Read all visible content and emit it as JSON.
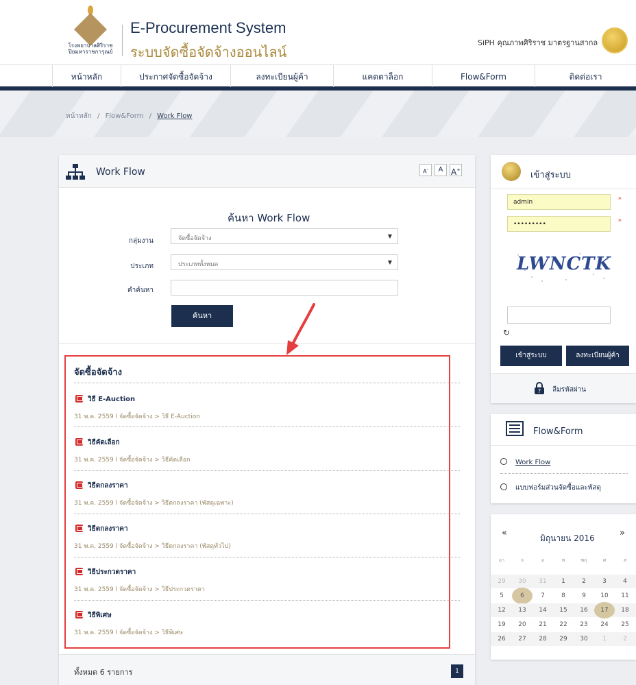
{
  "header": {
    "logo_text": "โรงพยาบาลศิริราช\nปิยมหาราชการุณย์",
    "title_en": "E-Procurement System",
    "title_th": "ระบบจัดซื้อจัดจ้างออนไลน์",
    "quality_text": "SiPH คุณภาพศิริราช มาตรฐานสากล"
  },
  "nav": [
    "หน้าหลัก",
    "ประกาศจัดซื้อจัดจ้าง",
    "ลงทะเบียนผู้ค้า",
    "แคตตาล็อก",
    "Flow&Form",
    "ติดต่อเรา"
  ],
  "breadcrumb": {
    "home": "หน้าหลัก",
    "sep": "/",
    "parent": "Flow&Form",
    "current": "Work Flow"
  },
  "panel": {
    "title": "Work Flow",
    "font_small": "A",
    "font_normal": "A",
    "font_large": "A",
    "font_small_sup": "-",
    "font_large_sup": "+",
    "search_title": "ค้นหา Work Flow",
    "group_label": "กลุ่มงาน",
    "group_value": "จัดซื้อจัดจ้าง",
    "type_label": "ประเภท",
    "type_value": "ประเภททั้งหมด",
    "keyword_label": "คำค้นหา",
    "search_button": "ค้นหา"
  },
  "results": {
    "section_title": "จัดซื้อจัดจ้าง",
    "items": [
      {
        "title": "วิธี E-Auction",
        "meta": "31 พ.ค. 2559 l จัดซื้อจัดจ้าง > วิธี E-Auction"
      },
      {
        "title": "วิธีคัดเลือก",
        "meta": "31 พ.ค. 2559 l จัดซื้อจัดจ้าง > วิธีคัดเลือก"
      },
      {
        "title": "วิธีตกลงราคา",
        "meta": "31 พ.ค. 2559 l จัดซื้อจัดจ้าง > วิธีตกลงราคา (พัสดุเฉพาะ)"
      },
      {
        "title": "วิธีตกลงราคา",
        "meta": "31 พ.ค. 2559 l จัดซื้อจัดจ้าง > วิธีตกลงราคา (พัสดุทั่วไป)"
      },
      {
        "title": "วิธีประกวดราคา",
        "meta": "31 พ.ค. 2559 l จัดซื้อจัดจ้าง > วิธีประกวดราคา"
      },
      {
        "title": "วิธีพิเศษ",
        "meta": "31 พ.ค. 2559 l จัดซื้อจัดจ้าง > วิธีพิเศษ"
      }
    ],
    "total": "ทั้งหมด 6 รายการ",
    "page": "1"
  },
  "login": {
    "title": "เข้าสู่ระบบ",
    "username": "admin",
    "password": "•••••••••",
    "captcha_text": "LWNCTK",
    "login_button": "เข้าสู่ระบบ",
    "register_button": "ลงทะเบียนผู้ค้า",
    "forgot": "ลืมรหัสผ่าน",
    "required_mark": "*"
  },
  "flowform": {
    "title": "Flow&Form",
    "links": [
      "Work Flow",
      "แบบฟอร์มส่วนจัดซื้อและพัสดุ"
    ]
  },
  "calendar": {
    "prev": "«",
    "next": "»",
    "month": "มิถุนายน 2016",
    "weekdays": [
      "อา",
      "จ",
      "อ",
      "พ",
      "พฤ",
      "ศ",
      "ส"
    ],
    "weeks": [
      [
        "29",
        "30",
        "31",
        "1",
        "2",
        "3",
        "4"
      ],
      [
        "5",
        "6",
        "7",
        "8",
        "9",
        "10",
        "11"
      ],
      [
        "12",
        "13",
        "14",
        "15",
        "16",
        "17",
        "18"
      ],
      [
        "19",
        "20",
        "21",
        "22",
        "23",
        "24",
        "25"
      ],
      [
        "26",
        "27",
        "28",
        "29",
        "30",
        "1",
        "2"
      ]
    ],
    "highlighted": [
      "6",
      "17"
    ]
  },
  "colors": {
    "navy": "#1d2f4f",
    "gold": "#a98a3c",
    "annotation_red": "#e53e3e"
  }
}
